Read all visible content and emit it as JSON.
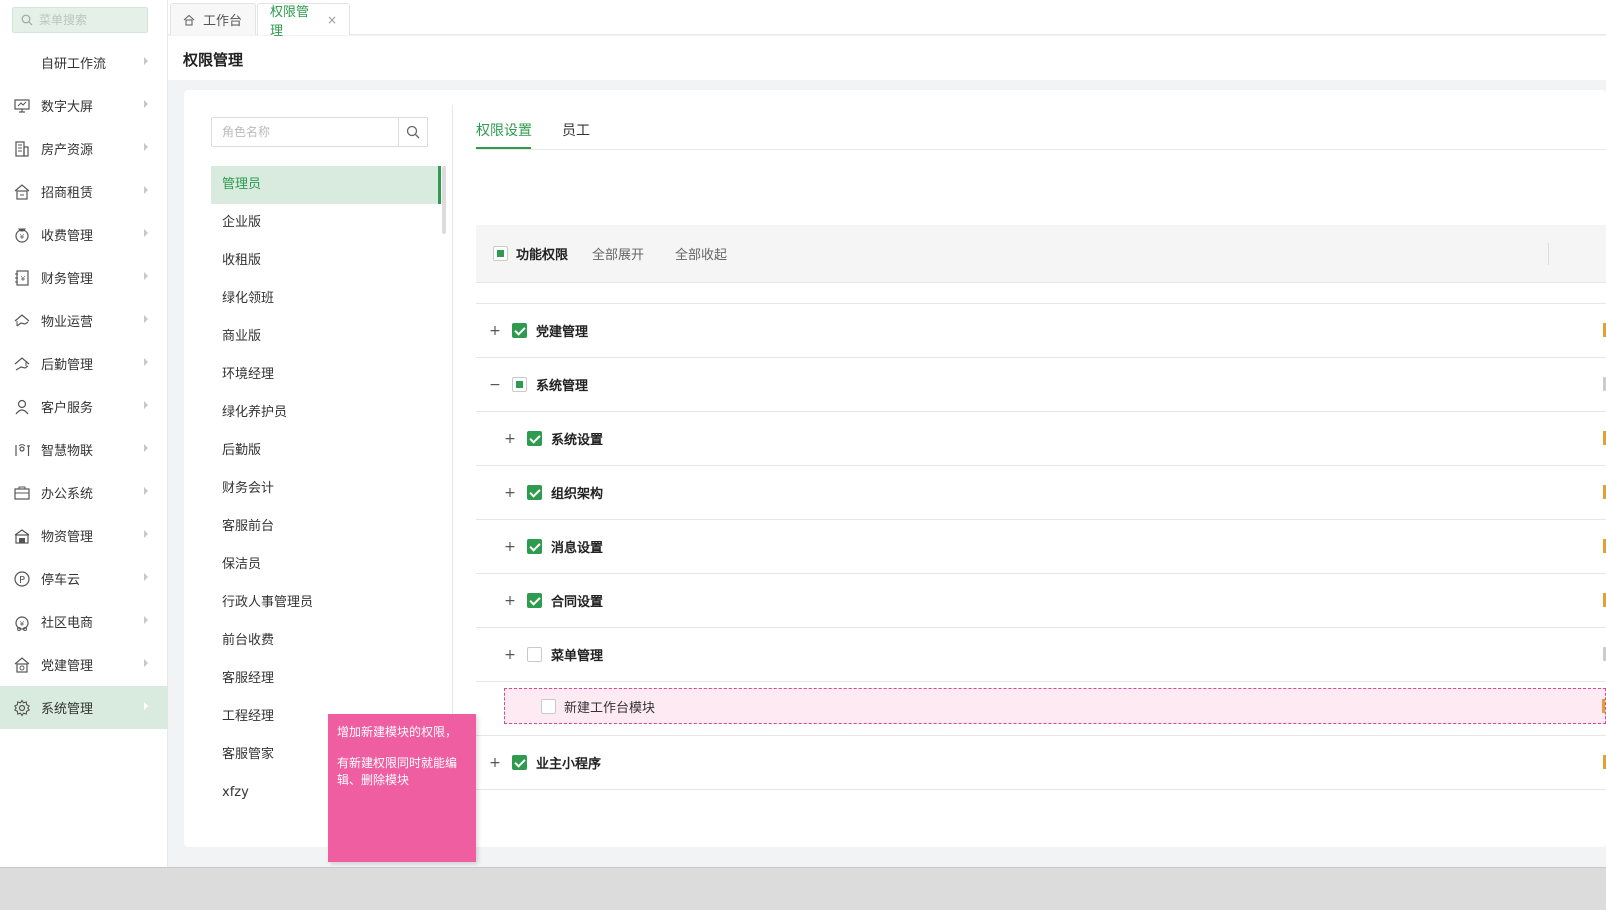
{
  "sidebar": {
    "search_placeholder": "菜单搜索",
    "items": [
      {
        "label": "自研工作流",
        "icon": "none"
      },
      {
        "label": "数字大屏",
        "icon": "monitor-icon"
      },
      {
        "label": "房产资源",
        "icon": "building-icon"
      },
      {
        "label": "招商租赁",
        "icon": "house-lease-icon"
      },
      {
        "label": "收费管理",
        "icon": "money-bag-icon"
      },
      {
        "label": "财务管理",
        "icon": "ledger-icon"
      },
      {
        "label": "物业运营",
        "icon": "house-hand-icon"
      },
      {
        "label": "后勤管理",
        "icon": "house-support-icon"
      },
      {
        "label": "客户服务",
        "icon": "user-icon"
      },
      {
        "label": "智慧物联",
        "icon": "iot-icon"
      },
      {
        "label": "办公系统",
        "icon": "briefcase-icon"
      },
      {
        "label": "物资管理",
        "icon": "warehouse-icon"
      },
      {
        "label": "停车云",
        "icon": "parking-icon"
      },
      {
        "label": "社区电商",
        "icon": "shop-bag-icon"
      },
      {
        "label": "党建管理",
        "icon": "party-house-icon"
      },
      {
        "label": "系统管理",
        "icon": "gear-icon"
      }
    ]
  },
  "tabs": [
    {
      "label": "工作台",
      "icon": "home-icon"
    },
    {
      "label": "权限管理",
      "close": "×"
    }
  ],
  "page": {
    "title": "权限管理"
  },
  "roles": {
    "search_placeholder": "角色名称",
    "items": [
      "管理员",
      "企业版",
      "收租版",
      "绿化领班",
      "商业版",
      "环境经理",
      "绿化养护员",
      "后勤版",
      "财务会计",
      "客服前台",
      "保洁员",
      "行政人事管理员",
      "前台收费",
      "客服经理",
      "工程经理",
      "客服管家",
      "xfzy"
    ]
  },
  "right_tabs": [
    "权限设置",
    "员工"
  ],
  "permissions": {
    "title": "功能权限",
    "expand_all": "全部展开",
    "collapse_all": "全部收起",
    "rows": [
      {
        "label": "党建管理",
        "toggle": "+",
        "checked": "on"
      },
      {
        "label": "系统管理",
        "toggle": "−",
        "checked": "half"
      },
      {
        "label": "系统设置",
        "toggle": "+",
        "checked": "on"
      },
      {
        "label": "组织架构",
        "toggle": "+",
        "checked": "on"
      },
      {
        "label": "消息设置",
        "toggle": "+",
        "checked": "on"
      },
      {
        "label": "合同设置",
        "toggle": "+",
        "checked": "on"
      },
      {
        "label": "菜单管理",
        "toggle": "+",
        "checked": "off"
      },
      {
        "label": "新建工作台模块",
        "checked": "off"
      },
      {
        "label": "业主小程序",
        "toggle": "+",
        "checked": "on"
      }
    ]
  },
  "note": {
    "line1": "增加新建模块的权限，",
    "line2": "有新建权限同时就能编辑、删除模块"
  },
  "colors": {
    "accent": "#2e9b4f",
    "note_bg": "#ee5ea1",
    "highlight_border": "#d64a8f"
  }
}
